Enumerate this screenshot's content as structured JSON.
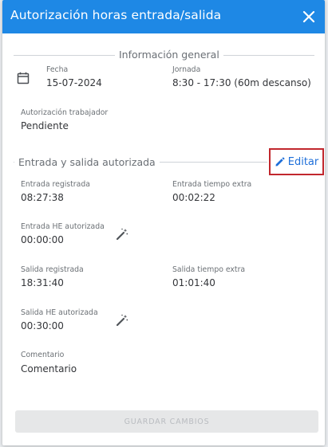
{
  "dialog": {
    "title": "Autorización horas entrada/salida",
    "close_icon": "close-icon"
  },
  "general": {
    "section_title": "Información general",
    "fecha_label": "Fecha",
    "fecha_value": "15-07-2024",
    "jornada_label": "Jornada",
    "jornada_value": "8:30 - 17:30 (60m descanso)",
    "autorizacion_label": "Autorización trabajador",
    "autorizacion_value": "Pendiente"
  },
  "authorized": {
    "section_title": "Entrada y salida autorizada",
    "edit_label": "Editar",
    "entrada_registrada_label": "Entrada registrada",
    "entrada_registrada_value": "08:27:38",
    "entrada_extra_label": "Entrada tiempo extra",
    "entrada_extra_value": "00:02:22",
    "entrada_he_label": "Entrada HE autorizada",
    "entrada_he_value": "00:00:00",
    "salida_registrada_label": "Salida registrada",
    "salida_registrada_value": "18:31:40",
    "salida_extra_label": "Salida tiempo extra",
    "salida_extra_value": "01:01:40",
    "salida_he_label": "Salida HE autorizada",
    "salida_he_value": "00:30:00",
    "comentario_label": "Comentario",
    "comentario_value": "Comentario"
  },
  "footer": {
    "save_label": "GUARDAR CAMBIOS"
  },
  "colors": {
    "header": "#1e88e5",
    "edit_text": "#1e6fd9",
    "edit_border": "#c1272d",
    "save_disabled_bg": "#e6e7e8"
  }
}
